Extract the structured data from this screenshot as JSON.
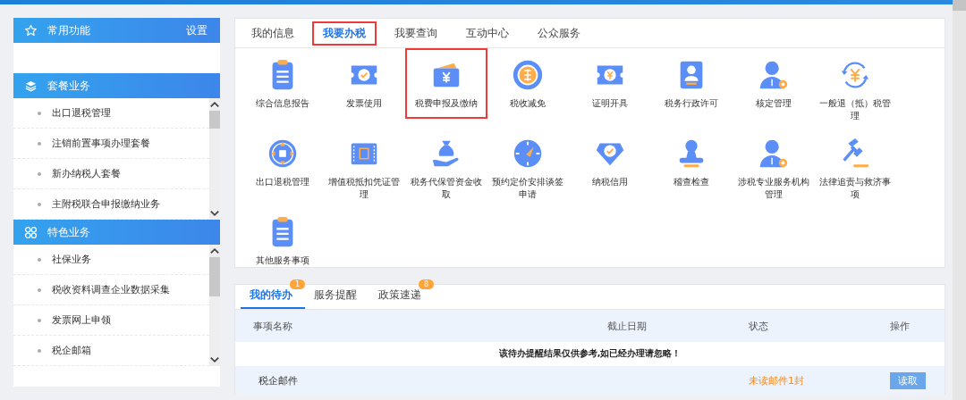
{
  "sidebar": {
    "sections": [
      {
        "kind": "favorites",
        "title": "常用功能",
        "action": "设置"
      },
      {
        "kind": "package",
        "title": "套餐业务",
        "items": [
          "出口退税管理",
          "注销前置事项办理套餐",
          "新办纳税人套餐",
          "主附税联合申报缴纳业务"
        ]
      },
      {
        "kind": "featured",
        "title": "特色业务",
        "items": [
          "社保业务",
          "税收资料调查企业数据采集",
          "发票网上申领",
          "税企邮箱"
        ]
      }
    ]
  },
  "tabs": [
    {
      "label": "我的信息",
      "selected": false,
      "highlighted": false
    },
    {
      "label": "我要办税",
      "selected": true,
      "highlighted": true
    },
    {
      "label": "我要查询",
      "selected": false,
      "highlighted": false
    },
    {
      "label": "互动中心",
      "selected": false,
      "highlighted": false
    },
    {
      "label": "公众服务",
      "selected": false,
      "highlighted": false
    }
  ],
  "services": [
    {
      "label": "综合信息报告",
      "kind": "clipboard",
      "highlighted": false
    },
    {
      "label": "发票使用",
      "kind": "ticket",
      "highlighted": false
    },
    {
      "label": "税费申报及缴纳",
      "kind": "wallet",
      "highlighted": true
    },
    {
      "label": "税收减免",
      "kind": "coin",
      "highlighted": false
    },
    {
      "label": "证明开具",
      "kind": "yen-ticket",
      "highlighted": false
    },
    {
      "label": "税务行政许可",
      "kind": "id-card",
      "highlighted": false
    },
    {
      "label": "核定管理",
      "kind": "user-gear",
      "highlighted": false
    },
    {
      "label": "一般退（抵）税管理",
      "kind": "refund",
      "highlighted": false
    },
    {
      "label": "出口退税管理",
      "kind": "globe",
      "highlighted": false
    },
    {
      "label": "增值税抵扣凭证管理",
      "kind": "voucher",
      "highlighted": false
    },
    {
      "label": "税务代保管资金收取",
      "kind": "money-bag",
      "highlighted": false
    },
    {
      "label": "预约定价安排谈签申请",
      "kind": "compass",
      "highlighted": false
    },
    {
      "label": "纳税信用",
      "kind": "badge",
      "highlighted": false
    },
    {
      "label": "稽查检查",
      "kind": "stamp",
      "highlighted": false
    },
    {
      "label": "涉税专业服务机构管理",
      "kind": "user-gear",
      "highlighted": false
    },
    {
      "label": "法律追责与救济事项",
      "kind": "gavel",
      "highlighted": false
    },
    {
      "label": "其他服务事项",
      "kind": "clipboard",
      "highlighted": false
    }
  ],
  "todo": {
    "tabs": [
      {
        "label": "我的待办",
        "badge": "1",
        "selected": true
      },
      {
        "label": "服务提醒",
        "selected": false
      },
      {
        "label": "政策速递",
        "badge": "8",
        "selected": false
      }
    ],
    "columns": [
      "事项名称",
      "截止日期",
      "状态",
      "操作"
    ],
    "notice": "该待办提醒结果仅供参考,如已经办理请忽略！",
    "rows": [
      {
        "name": "税企邮件",
        "status": "未读邮件1封",
        "action": "读取"
      }
    ]
  }
}
